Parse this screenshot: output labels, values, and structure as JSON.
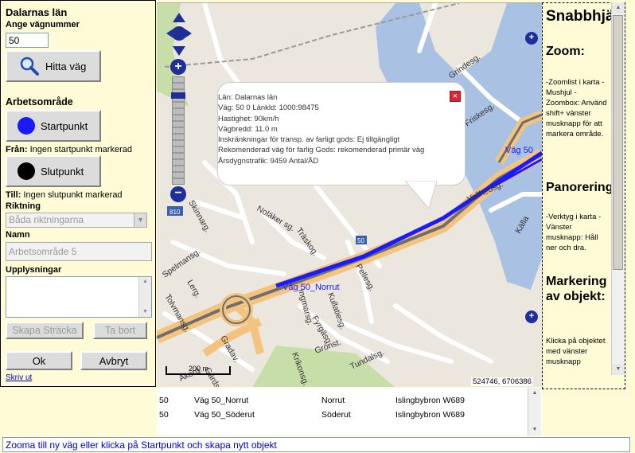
{
  "left": {
    "title": "Dalarnas län",
    "road_label": "Ange vägnummer",
    "road_value": "50",
    "find_button": "Hitta väg",
    "work_area": "Arbetsområde",
    "start_button": "Startpunkt",
    "from_label": "Från:",
    "from_text": "Ingen startpunkt markerad",
    "end_button": "Slutpunkt",
    "to_label": "Till:",
    "to_text": "Ingen slutpunkt markerad",
    "direction_label": "Riktning",
    "direction_value": "Båda riktningarna",
    "name_label": "Namn",
    "name_value": "Arbetsområde 5",
    "info_label": "Upplysningar",
    "create_button": "Skapa Sträcka",
    "remove_button": "Ta bort",
    "ok_button": "Ok",
    "cancel_button": "Avbryt",
    "print_link": "Skriv ut"
  },
  "popup": {
    "lines": [
      "Län: Dalarnas län",
      "Väg: 50 0 Länkld: 1000:98475",
      "Hastighet: 90km/h",
      "Vägbredd: 11.0 m",
      "Inskränkningar för transp. av farligt gods: Ej tillgängligt",
      "Rekomenderad väg för farlig Gods: rekomenderad primär väg",
      "Årsdygnstrafik: 9459 Antal/ÅD"
    ]
  },
  "map": {
    "scale": "200 m",
    "coords": "524746, 6706386",
    "road_label_1": "Väg 50_Norrut",
    "road_label_2": "Väg 50",
    "shield_810": "810",
    "shield_50": "50",
    "streets": [
      "Grindesg.",
      "Friskesg.",
      "Vallhedsg.",
      "Källa",
      "Noläker sg.",
      "Träskog.",
      "Skinnarg.",
      "Spelmansg.",
      "Lerg.",
      "Tolvmansg.",
      "Gradav.",
      "Ingmarsg.",
      "Pellesg.",
      "Kullatiesg.",
      "Fyrgäsg.",
      "Grönst.",
      "Krikonsg.",
      "Tundalsg.",
      "Åkerg.",
      "Gärdsg."
    ]
  },
  "help": {
    "title": "Snabbhjälp",
    "zoom_h": "Zoom:",
    "zoom_t": "-Zoomlist i karta - Mushjul -Zoombox: Använd shift+ vänster musknapp för att markera område.",
    "pan_h": "Panorering:",
    "pan_t": "-Verktyg i karta -Vänster musknapp: Håll ner och dra.",
    "mark_h": "Markering av objekt:",
    "mark_t": "Klicka på objektet med vänster musknapp"
  },
  "list": {
    "rows": [
      {
        "nr": "50",
        "name": "Väg 50_Norrut",
        "dir": "Norrut",
        "place": "Islingbybron W689"
      },
      {
        "nr": "50",
        "name": "Väg 50_Söderut",
        "dir": "Söderut",
        "place": "Islingbybron W689"
      }
    ]
  },
  "status": "Zooma till ny väg eller klicka på Startpunkt och skapa nytt objekt",
  "colors": {
    "bg": "#fffbd6",
    "route": "#1a1aff",
    "water": "#a9c1e3",
    "park": "#c7dea8",
    "link": "#0000c8"
  }
}
